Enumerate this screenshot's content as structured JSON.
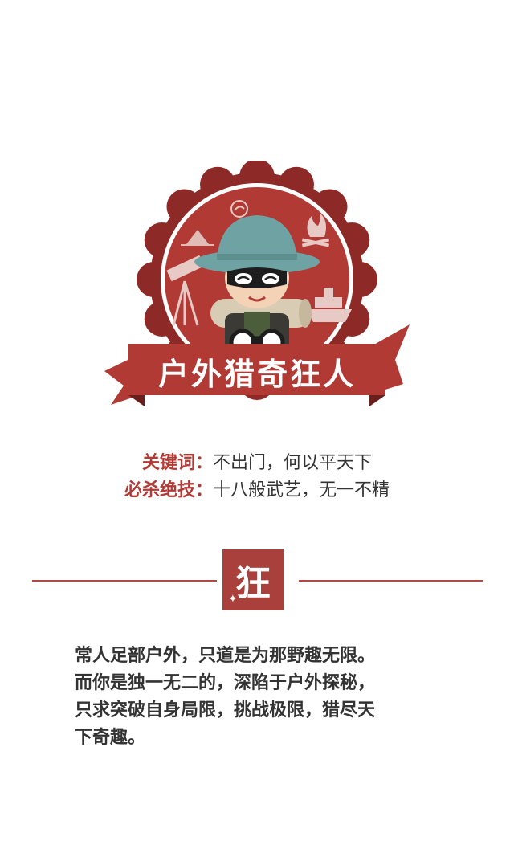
{
  "badge": {
    "title": "户外猎奇狂人",
    "colors": {
      "primary": "#b13a35",
      "dark": "#8d2a27",
      "hat": "#6fa3a3"
    }
  },
  "info": {
    "keyword_label": "关键词：",
    "keyword_value": "不出门，何以平天下",
    "skill_label": "必杀绝技：",
    "skill_value": "十八般武艺，无一不精"
  },
  "stamp": {
    "character": "狂"
  },
  "description": {
    "lines": [
      "常人足部户外，只道是为那野趣无限。",
      "而你是独一无二的，深陷于户外探秘，",
      "只求突破自身局限，挑战极限，猎尽天",
      "下奇趣。"
    ]
  }
}
